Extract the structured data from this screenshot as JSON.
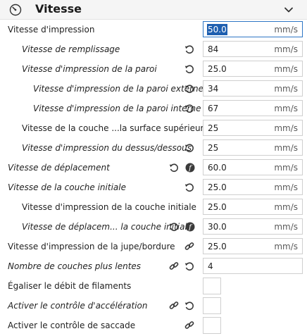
{
  "section": {
    "title": "Vitesse"
  },
  "rows": [
    {
      "label": "Vitesse d'impression",
      "value": "50.0",
      "unit": "mm/s"
    },
    {
      "label": "Vitesse de remplissage",
      "value": "84",
      "unit": "mm/s"
    },
    {
      "label": "Vitesse d'impression de la paroi",
      "value": "25.0",
      "unit": "mm/s"
    },
    {
      "label": "Vitesse d'impression de la paroi externe",
      "value": "34",
      "unit": "mm/s"
    },
    {
      "label": "Vitesse d'impression de la paroi interne",
      "value": "67",
      "unit": "mm/s"
    },
    {
      "label": "Vitesse de la couche ...la surface supérieure",
      "value": "25",
      "unit": "mm/s"
    },
    {
      "label": "Vitesse d'impression du dessus/dessous",
      "value": "25",
      "unit": "mm/s"
    },
    {
      "label": "Vitesse de déplacement",
      "value": "60.0",
      "unit": "mm/s"
    },
    {
      "label": "Vitesse de la couche initiale",
      "value": "25.0",
      "unit": "mm/s"
    },
    {
      "label": "Vitesse d'impression de la couche initiale",
      "value": "25.0",
      "unit": "mm/s"
    },
    {
      "label": "Vitesse de déplacem... la couche initiale",
      "value": "30.0",
      "unit": "mm/s"
    },
    {
      "label": "Vitesse d'impression de la jupe/bordure",
      "value": "25.0",
      "unit": "mm/s"
    },
    {
      "label": "Nombre de couches plus lentes",
      "value": "4",
      "unit": ""
    },
    {
      "label": "Égaliser le débit de filaments"
    },
    {
      "label": "Activer le contrôle d'accélération"
    },
    {
      "label": "Activer le contrôle de saccade"
    }
  ],
  "colors": {
    "header_bg": "#f5f5f5",
    "selection": "#1e5fb0",
    "icon": "#3a3a3a"
  }
}
